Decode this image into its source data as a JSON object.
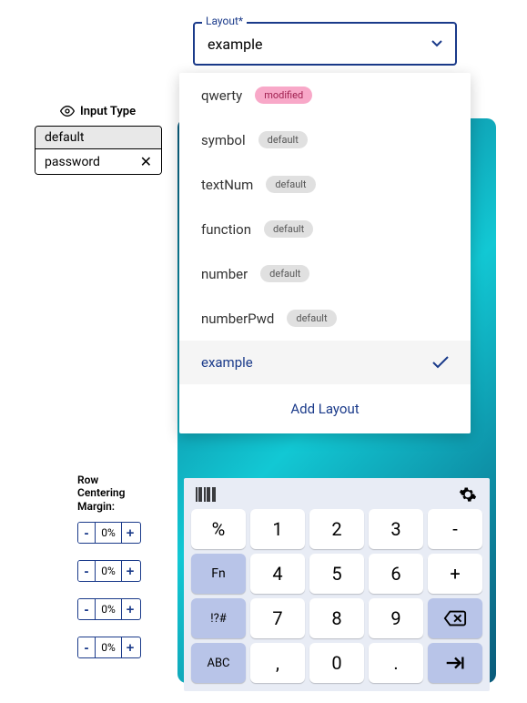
{
  "input_type": {
    "header": "Input Type",
    "items": [
      {
        "label": "default",
        "selected": true
      },
      {
        "label": "password",
        "closable": true
      }
    ]
  },
  "layout": {
    "label": "Layout*",
    "selected": "example",
    "options": [
      {
        "name": "qwerty",
        "badge": "modified",
        "badgeType": "modified"
      },
      {
        "name": "symbol",
        "badge": "default",
        "badgeType": "default"
      },
      {
        "name": "textNum",
        "badge": "default",
        "badgeType": "default"
      },
      {
        "name": "function",
        "badge": "default",
        "badgeType": "default"
      },
      {
        "name": "number",
        "badge": "default",
        "badgeType": "default"
      },
      {
        "name": "numberPwd",
        "badge": "default",
        "badgeType": "default"
      },
      {
        "name": "example",
        "selected": true
      }
    ],
    "addLabel": "Add Layout"
  },
  "row_margin": {
    "label": "Row Centering Margin:",
    "values": [
      "0%",
      "0%",
      "0%",
      "0%"
    ]
  },
  "keyboard": {
    "rows": [
      [
        "%",
        "1",
        "2",
        "3",
        "-"
      ],
      [
        "Fn",
        "4",
        "5",
        "6",
        "+"
      ],
      [
        "!?#",
        "7",
        "8",
        "9",
        "backspace"
      ],
      [
        "ABC",
        ",",
        "0",
        ".",
        "tab"
      ]
    ]
  }
}
